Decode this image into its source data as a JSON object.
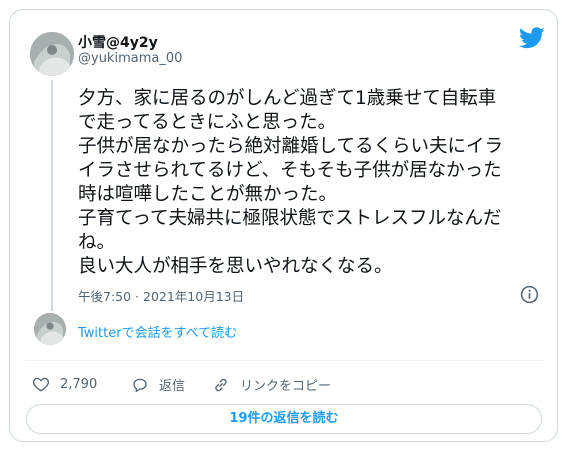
{
  "author": {
    "display_name": "小雪@4y2y",
    "handle": "@yukimama_00"
  },
  "tweet": {
    "lines": [
      "夕方、家に居るのがしんど過ぎて1歳乗せて自転車",
      "で走ってるときにふと思った。",
      "子供が居なかったら絶対離婚してるくらい夫にイラ",
      "イラさせられてるけど、そもそも子供が居なかった",
      "時は喧嘩したことが無かった。",
      "子育てって夫婦共に極限状態でストレスフルなんだ",
      "ね。",
      "良い大人が相手を思いやれなくなる。"
    ],
    "timestamp": "午後7:50 · 2021年10月13日"
  },
  "conversation_link": "Twitterで会話をすべて読む",
  "actions": {
    "like_count": "2,790",
    "reply_label": "返信",
    "copy_link_label": "リンクをコピー"
  },
  "replies_button": "19件の返信を読む",
  "icons": {
    "brand": "twitter-bird-icon",
    "info": "info-icon",
    "like": "heart-icon",
    "reply": "reply-icon",
    "link": "link-icon"
  },
  "colors": {
    "accent": "#1d9bf0",
    "text": "#0f1419",
    "secondary": "#536471",
    "border": "#cfd9de"
  }
}
